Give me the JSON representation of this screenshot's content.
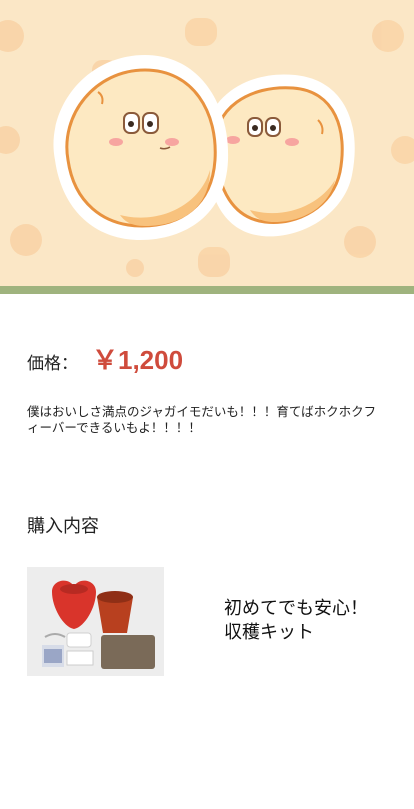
{
  "hero": {
    "image_desc": "two-potato-characters-illustration",
    "background_color": "#fbe7c6",
    "accent_color": "#9fb37e"
  },
  "product": {
    "price_label": "価格：",
    "price_value": "￥1,200",
    "price_color": "#cf4b3c",
    "description": "僕はおいしさ満点のジャガイモだいも！！！育てばホクホクフィーバーできるいもよ！！！！"
  },
  "contents": {
    "title": "購入内容",
    "kit_name_line1": "初めてでも安心！",
    "kit_name_line2": "収穫キット",
    "photo_icon": "kit-photo"
  }
}
